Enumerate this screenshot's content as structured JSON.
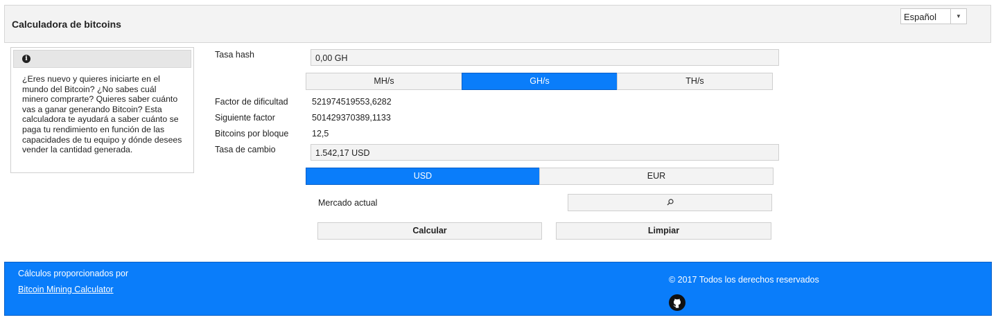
{
  "header": {
    "title": "Calculadora de bitcoins",
    "language": "Español"
  },
  "info": {
    "icon": "info-icon",
    "text": "¿Eres nuevo y quieres iniciarte en el mundo del Bitcoin? ¿No sabes cuál minero comprarte? Quieres saber cuánto vas a ganar generando Bitcoin? Esta calculadora te ayudará a saber cuánto se paga tu rendimiento en función de las capacidades de tu equipo y dónde desees vender la cantidad generada."
  },
  "form": {
    "hash_rate_label": "Tasa hash",
    "hash_rate_value": "0,00 GH",
    "hash_units": [
      "MH/s",
      "GH/s",
      "TH/s"
    ],
    "hash_unit_selected": "GH/s",
    "difficulty_label": "Factor de dificultad",
    "difficulty_value": "521974519553,6282",
    "next_difficulty_label": "Siguiente factor",
    "next_difficulty_value": "501429370389,1133",
    "block_reward_label": "Bitcoins por bloque",
    "block_reward_value": "12,5",
    "exchange_rate_label": "Tasa de cambio",
    "exchange_rate_value": "1.542,17 USD",
    "currencies": [
      "USD",
      "EUR"
    ],
    "currency_selected": "USD",
    "market_label": "Mercado actual",
    "market_icon": "search-icon",
    "calculate_label": "Calcular",
    "clear_label": "Limpiar"
  },
  "footer": {
    "credit": "Cálculos proporcionados por",
    "link": "Bitcoin Mining Calculator",
    "copyright": "© 2017 Todos los derechos reservados",
    "icon": "github-icon"
  },
  "colors": {
    "accent": "#0a7dfa",
    "panel": "#f3f3f3",
    "border": "#cfcfcf"
  }
}
